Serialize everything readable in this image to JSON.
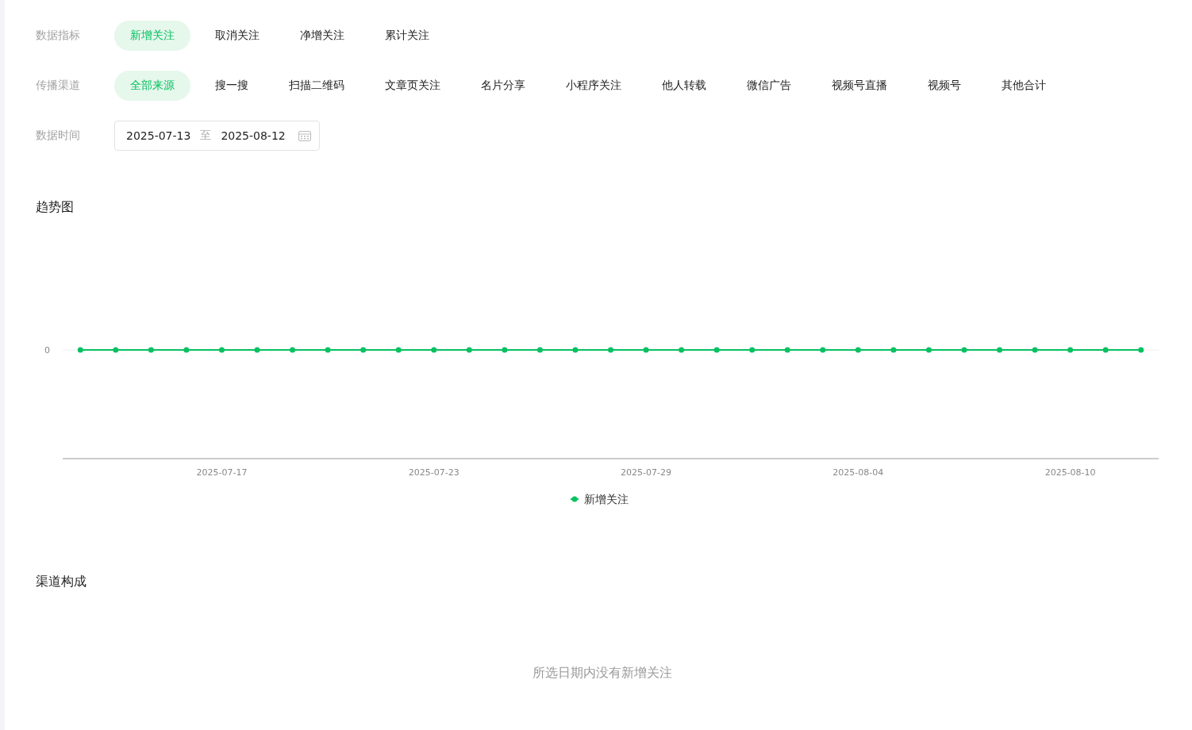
{
  "filters": [
    {
      "label": "数据指标",
      "options": [
        {
          "label": "新增关注",
          "selected": true
        },
        {
          "label": "取消关注",
          "selected": false
        },
        {
          "label": "净增关注",
          "selected": false
        },
        {
          "label": "累计关注",
          "selected": false
        }
      ]
    },
    {
      "label": "传播渠道",
      "options": [
        {
          "label": "全部来源",
          "selected": true
        },
        {
          "label": "搜一搜",
          "selected": false
        },
        {
          "label": "扫描二维码",
          "selected": false
        },
        {
          "label": "文章页关注",
          "selected": false
        },
        {
          "label": "名片分享",
          "selected": false
        },
        {
          "label": "小程序关注",
          "selected": false
        },
        {
          "label": "他人转载",
          "selected": false
        },
        {
          "label": "微信广告",
          "selected": false
        },
        {
          "label": "视频号直播",
          "selected": false
        },
        {
          "label": "视频号",
          "selected": false
        },
        {
          "label": "其他合计",
          "selected": false
        }
      ]
    }
  ],
  "date_range": {
    "label": "数据时间",
    "start": "2025-07-13",
    "separator": "至",
    "end": "2025-08-12"
  },
  "trend": {
    "title": "趋势图",
    "y_axis_tick": "0",
    "x_axis_labels": [
      "2025-07-17",
      "2025-07-23",
      "2025-07-29",
      "2025-08-04",
      "2025-08-10"
    ],
    "legend": "新增关注"
  },
  "channel_mix": {
    "title": "渠道构成",
    "empty_message": "所选日期内没有新增关注"
  }
}
